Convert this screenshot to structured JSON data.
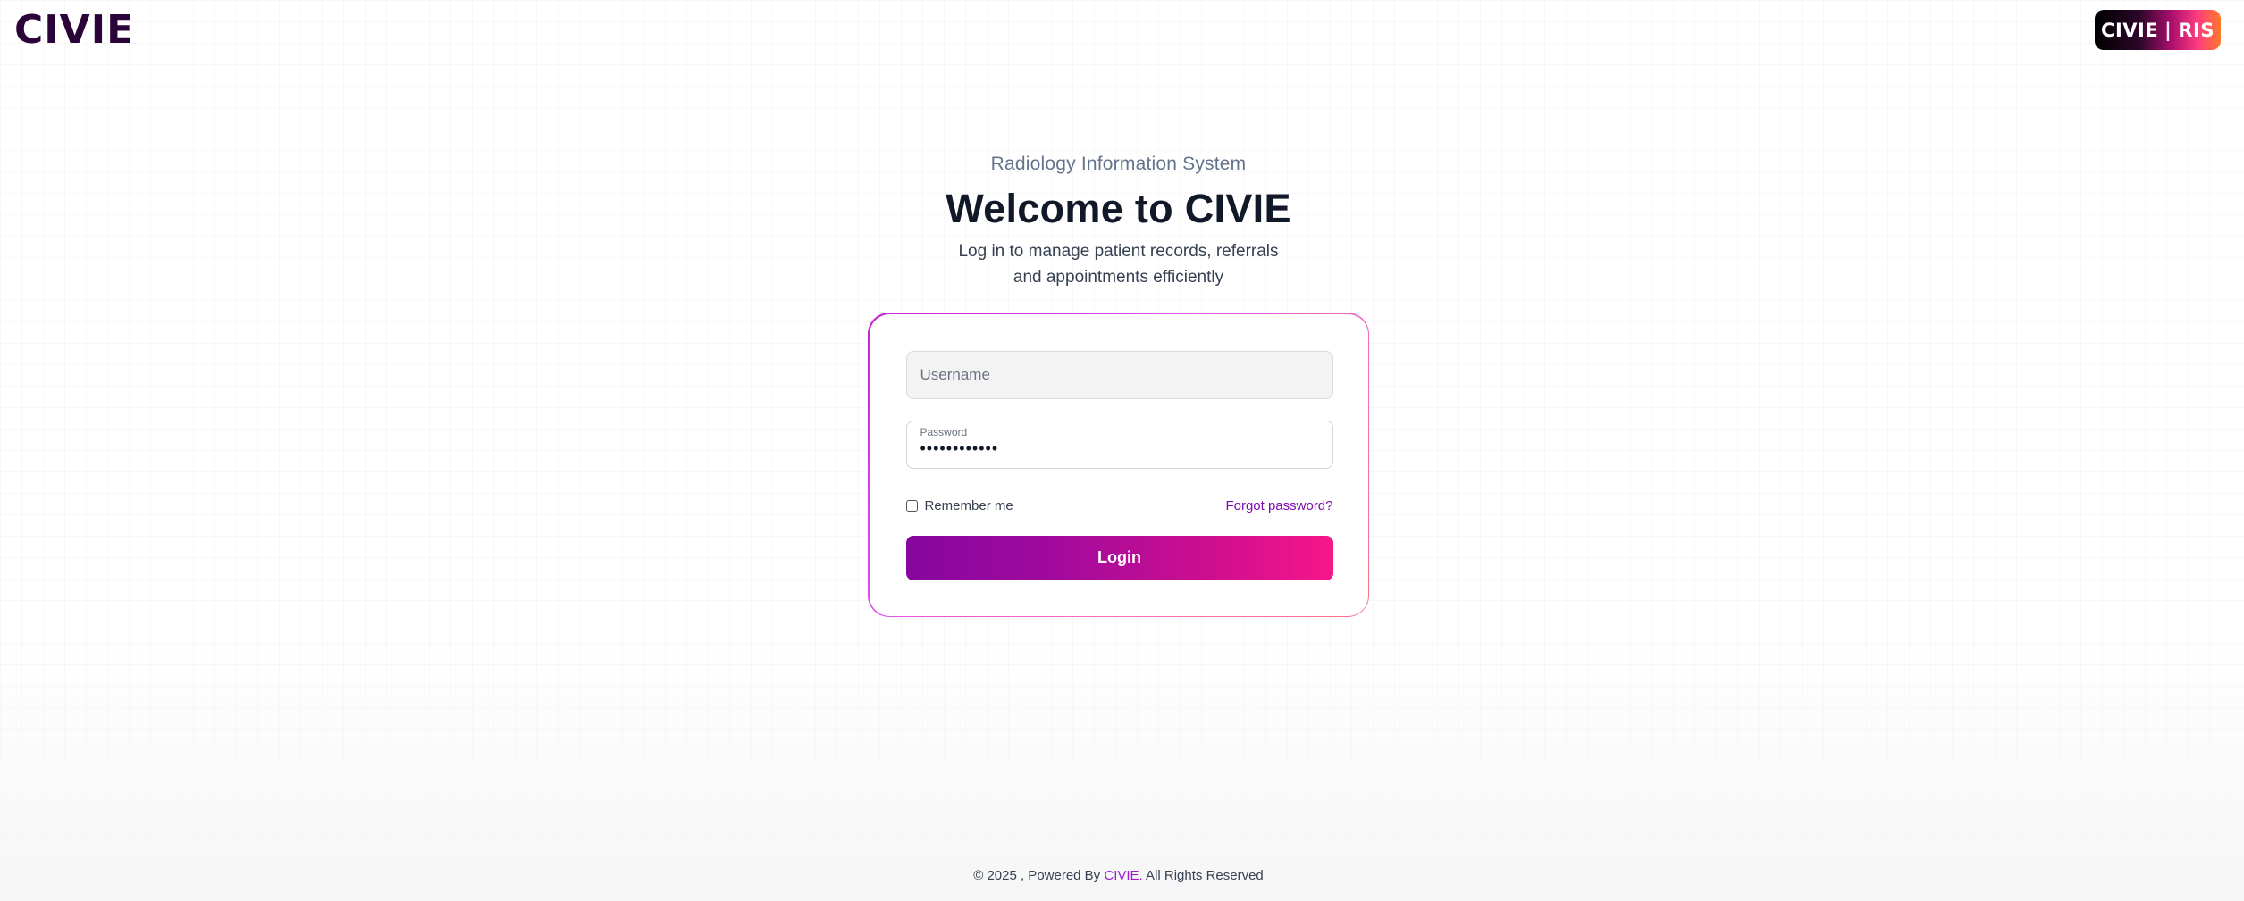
{
  "header": {
    "logo_text": "CIVIE",
    "badge": {
      "left": "CIVIE",
      "separator": "|",
      "right": "RIS"
    }
  },
  "hero": {
    "subtitle": "Radiology Information System",
    "title": "Welcome to CIVIE",
    "tagline_line1": "Log in to manage patient records, referrals",
    "tagline_line2": "and appointments efficiently"
  },
  "form": {
    "username": {
      "placeholder": "Username",
      "value": ""
    },
    "password": {
      "label": "Password",
      "value": "••••••••••••"
    },
    "remember_label": "Remember me",
    "remember_checked": false,
    "forgot_label": "Forgot password?",
    "login_label": "Login"
  },
  "footer": {
    "prefix": "© 2025 , Powered By ",
    "brand": "CIVIE.",
    "suffix": " All Rights Reserved"
  },
  "colors": {
    "accent": "#86069e",
    "accent_end": "#f7168a",
    "link": "#7e0bb0",
    "brand_dark": "#2a0438"
  }
}
